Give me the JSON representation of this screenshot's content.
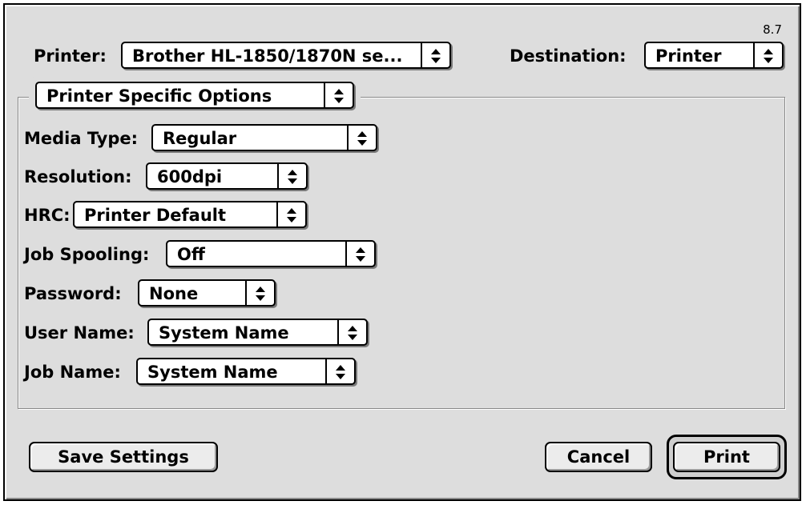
{
  "version": "8.7",
  "printer": {
    "label": "Printer:",
    "value": "Brother HL-1850/1870N se..."
  },
  "destination": {
    "label": "Destination:",
    "value": "Printer"
  },
  "section_menu": {
    "value": "Printer Specific Options"
  },
  "options": [
    {
      "label": "Media Type:",
      "value": "Regular"
    },
    {
      "label": "Resolution:",
      "value": "600dpi"
    },
    {
      "label": "HRC:",
      "value": "Printer Default"
    },
    {
      "label": "Job Spooling:",
      "value": "Off"
    },
    {
      "label": "Password:",
      "value": "None"
    },
    {
      "label": "User Name:",
      "value": "System Name"
    },
    {
      "label": "Job Name:",
      "value": "System Name"
    }
  ],
  "buttons": {
    "save": "Save Settings",
    "cancel": "Cancel",
    "print": "Print"
  }
}
